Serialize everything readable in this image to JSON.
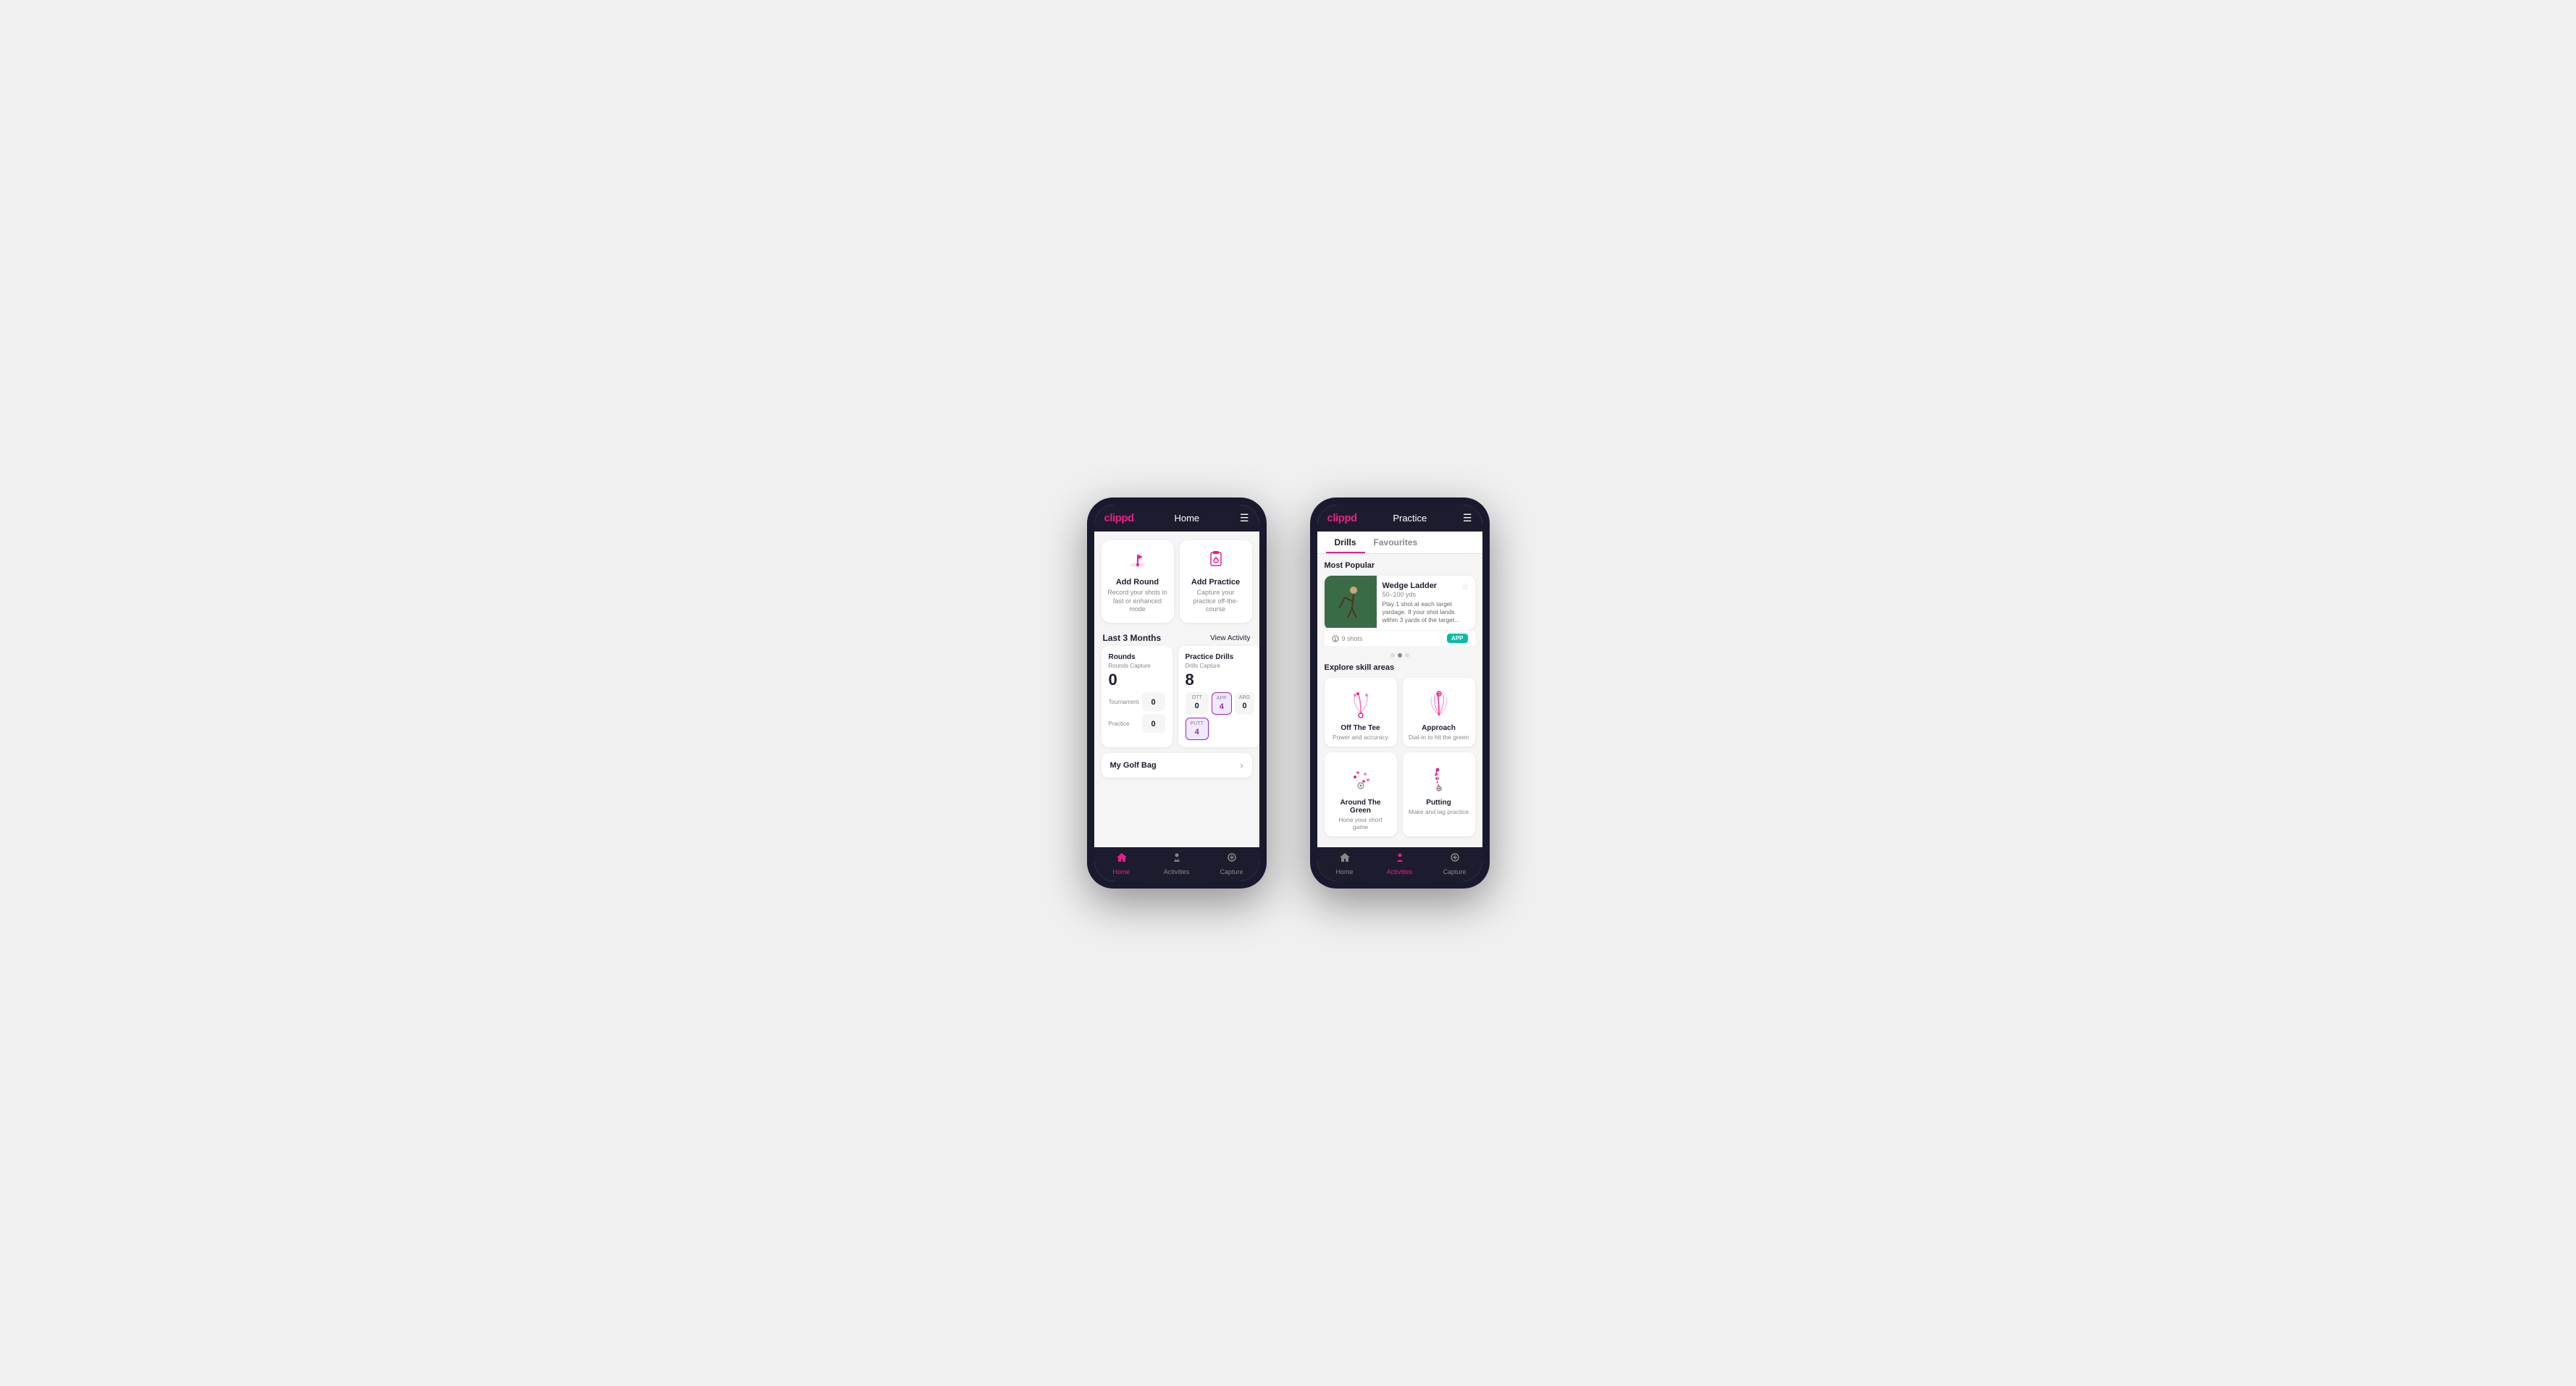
{
  "phone1": {
    "header": {
      "logo": "clippd",
      "title": "Home",
      "menuIcon": "☰"
    },
    "actionCards": [
      {
        "id": "add-round",
        "icon": "⛳",
        "title": "Add Round",
        "desc": "Record your shots in fast or enhanced mode"
      },
      {
        "id": "add-practice",
        "icon": "📋",
        "title": "Add Practice",
        "desc": "Capture your practice off-the-course"
      }
    ],
    "activitySection": {
      "title": "Last 3 Months",
      "viewLink": "View Activity"
    },
    "rounds": {
      "title": "Rounds",
      "captureLabel": "Rounds Capture",
      "total": "0",
      "rows": [
        {
          "label": "Tournament",
          "value": "0"
        },
        {
          "label": "Practice",
          "value": "0"
        }
      ]
    },
    "practiceDrills": {
      "title": "Practice Drills",
      "captureLabel": "Drills Capture",
      "total": "8",
      "cells": [
        {
          "label": "OTT",
          "value": "0"
        },
        {
          "label": "APP",
          "value": "4",
          "highlight": true
        },
        {
          "label": "ARG",
          "value": "0"
        },
        {
          "label": "PUTT",
          "value": "4",
          "highlight": true
        }
      ]
    },
    "myGolfBag": {
      "title": "My Golf Bag"
    },
    "bottomNav": [
      {
        "icon": "🏠",
        "label": "Home",
        "active": true
      },
      {
        "icon": "🏌️",
        "label": "Activities",
        "active": false
      },
      {
        "icon": "➕",
        "label": "Capture",
        "active": false
      }
    ]
  },
  "phone2": {
    "header": {
      "logo": "clippd",
      "title": "Practice",
      "menuIcon": "☰"
    },
    "tabs": [
      {
        "label": "Drills",
        "active": true
      },
      {
        "label": "Favourites",
        "active": false
      }
    ],
    "mostPopular": {
      "sectionTitle": "Most Popular",
      "featuredDrill": {
        "name": "Wedge Ladder",
        "distance": "50–100 yds",
        "description": "Play 1 shot at each target yardage. If your shot lands within 3 yards of the target...",
        "shots": "9 shots",
        "badge": "APP"
      },
      "dots": [
        false,
        true,
        false
      ]
    },
    "exploreSection": {
      "title": "Explore skill areas",
      "skills": [
        {
          "id": "off-the-tee",
          "name": "Off The Tee",
          "desc": "Power and accuracy"
        },
        {
          "id": "approach",
          "name": "Approach",
          "desc": "Dial-in to hit the green"
        },
        {
          "id": "around-the-green",
          "name": "Around The Green",
          "desc": "Hone your short game"
        },
        {
          "id": "putting",
          "name": "Putting",
          "desc": "Make and lag practice"
        }
      ]
    },
    "bottomNav": [
      {
        "icon": "🏠",
        "label": "Home",
        "active": false
      },
      {
        "icon": "🏌️",
        "label": "Activities",
        "active": true
      },
      {
        "icon": "➕",
        "label": "Capture",
        "active": false
      }
    ]
  }
}
